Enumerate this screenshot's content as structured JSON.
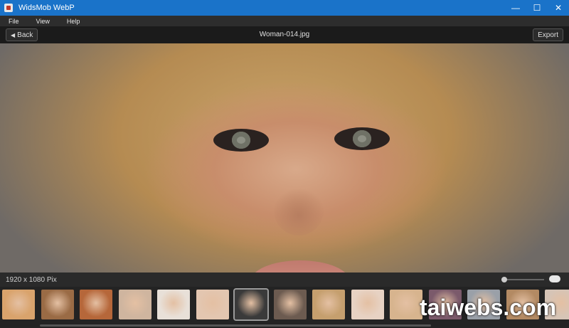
{
  "window": {
    "title": "WidsMob WebP",
    "controls": [
      "—",
      "☐",
      "✕"
    ]
  },
  "menu": {
    "items": [
      "File",
      "View",
      "Help"
    ]
  },
  "toolbar": {
    "back_label": "Back",
    "file_name": "Woman-014.jpg",
    "export_label": "Export"
  },
  "status": {
    "dimensions": "1920 x 1080 Pix"
  },
  "filmstrip": {
    "thumbnails": [
      {
        "color": "#d9a36c",
        "selected": false
      },
      {
        "color": "#9a6b45",
        "selected": false
      },
      {
        "color": "#b6673a",
        "selected": false
      },
      {
        "color": "#cfb59f",
        "selected": false
      },
      {
        "color": "#e8e0d8",
        "selected": false
      },
      {
        "color": "#e3c6b0",
        "selected": false
      },
      {
        "color": "#3a3a3a",
        "selected": true
      },
      {
        "color": "#6c5b50",
        "selected": false
      },
      {
        "color": "#c59f6e",
        "selected": false
      },
      {
        "color": "#e7d2c3",
        "selected": false
      },
      {
        "color": "#d7b48e",
        "selected": false
      },
      {
        "color": "#7b5a6b",
        "selected": false
      },
      {
        "color": "#9aa0a8",
        "selected": false
      },
      {
        "color": "#b38a63",
        "selected": false
      },
      {
        "color": "#d6c4b6",
        "selected": false
      }
    ]
  },
  "watermark": "taiwebs.com",
  "colors": {
    "titlebar": "#1a73c9",
    "background": "#1e1e1e"
  }
}
